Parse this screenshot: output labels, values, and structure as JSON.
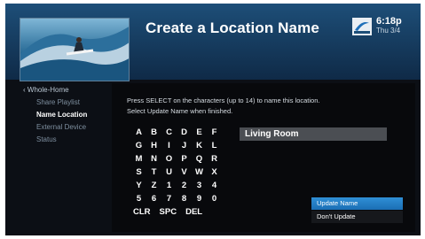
{
  "header": {
    "title": "Create a Location Name",
    "time": "6:18p",
    "date": "Thu 3/4",
    "logo_icon": "directv-logo-icon"
  },
  "sidebar": {
    "back_label": "Whole-Home",
    "items": [
      {
        "label": "Share Playlist",
        "active": false
      },
      {
        "label": "Name Location",
        "active": true
      },
      {
        "label": "External Device",
        "active": false
      },
      {
        "label": "Status",
        "active": false
      }
    ]
  },
  "panel": {
    "instructions_line1": "Press SELECT on the characters (up to 14) to name this location.",
    "instructions_line2": "Select Update Name when finished.",
    "name_value": "Living Room"
  },
  "keyboard": {
    "rows": [
      [
        "A",
        "B",
        "C",
        "D",
        "E",
        "F"
      ],
      [
        "G",
        "H",
        "I",
        "J",
        "K",
        "L"
      ],
      [
        "M",
        "N",
        "O",
        "P",
        "Q",
        "R"
      ],
      [
        "S",
        "T",
        "U",
        "V",
        "W",
        "X"
      ],
      [
        "Y",
        "Z",
        "1",
        "2",
        "3",
        "4"
      ],
      [
        "5",
        "6",
        "7",
        "8",
        "9",
        "0"
      ],
      [
        "CLR",
        "SPC",
        "DEL"
      ]
    ]
  },
  "actions": {
    "update_label": "Update Name",
    "dont_update_label": "Don't Update"
  },
  "colors": {
    "selected": "#2f8fd6",
    "header": "#1d4e78",
    "panel_bg": "#08090c"
  }
}
